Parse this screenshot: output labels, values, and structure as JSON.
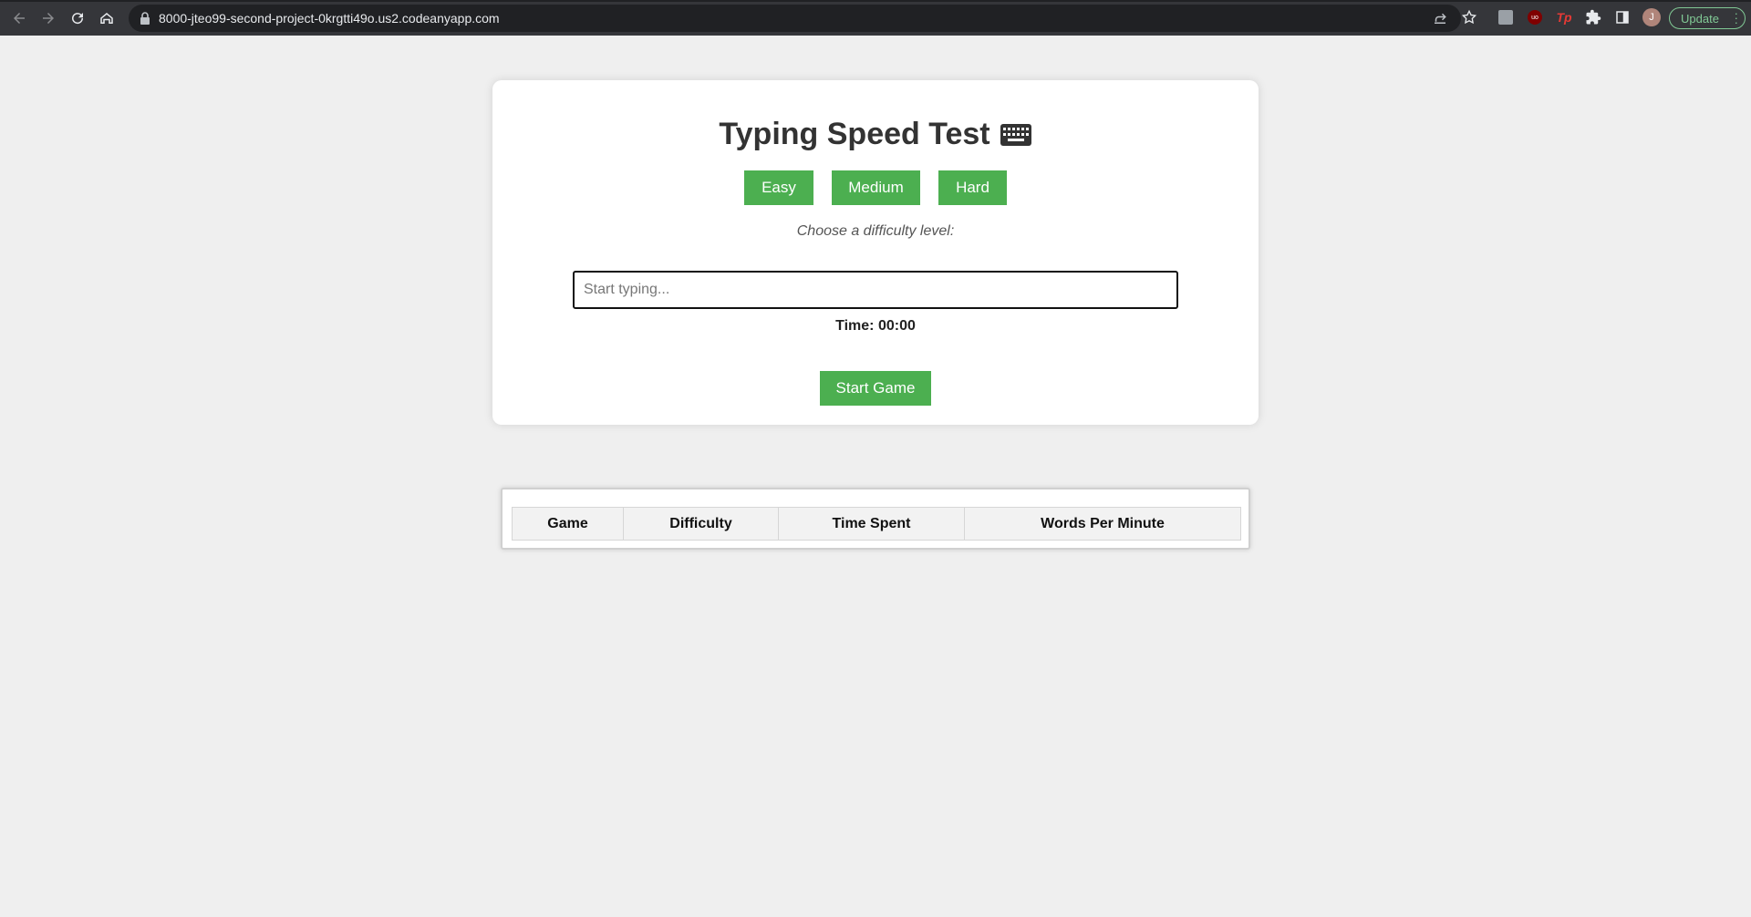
{
  "browser": {
    "url": "8000-jteo99-second-project-0krgtti49o.us2.codeanyapp.com",
    "avatar_initial": "J",
    "update_label": "Update",
    "extensions": [
      "profile-extension-icon",
      "ublock-icon",
      "tp-extension-icon",
      "puzzle-icon",
      "side-panel-icon"
    ]
  },
  "app": {
    "title": "Typing Speed Test",
    "title_icon": "keyboard-icon",
    "difficulty_buttons": [
      "Easy",
      "Medium",
      "Hard"
    ],
    "difficulty_hint": "Choose a difficulty level:",
    "input_placeholder": "Start typing...",
    "timer_label": "Time: 00:00",
    "start_label": "Start Game",
    "accent_color": "#4caf50"
  },
  "results": {
    "columns": [
      "Game",
      "Difficulty",
      "Time Spent",
      "Words Per Minute"
    ],
    "rows": []
  }
}
